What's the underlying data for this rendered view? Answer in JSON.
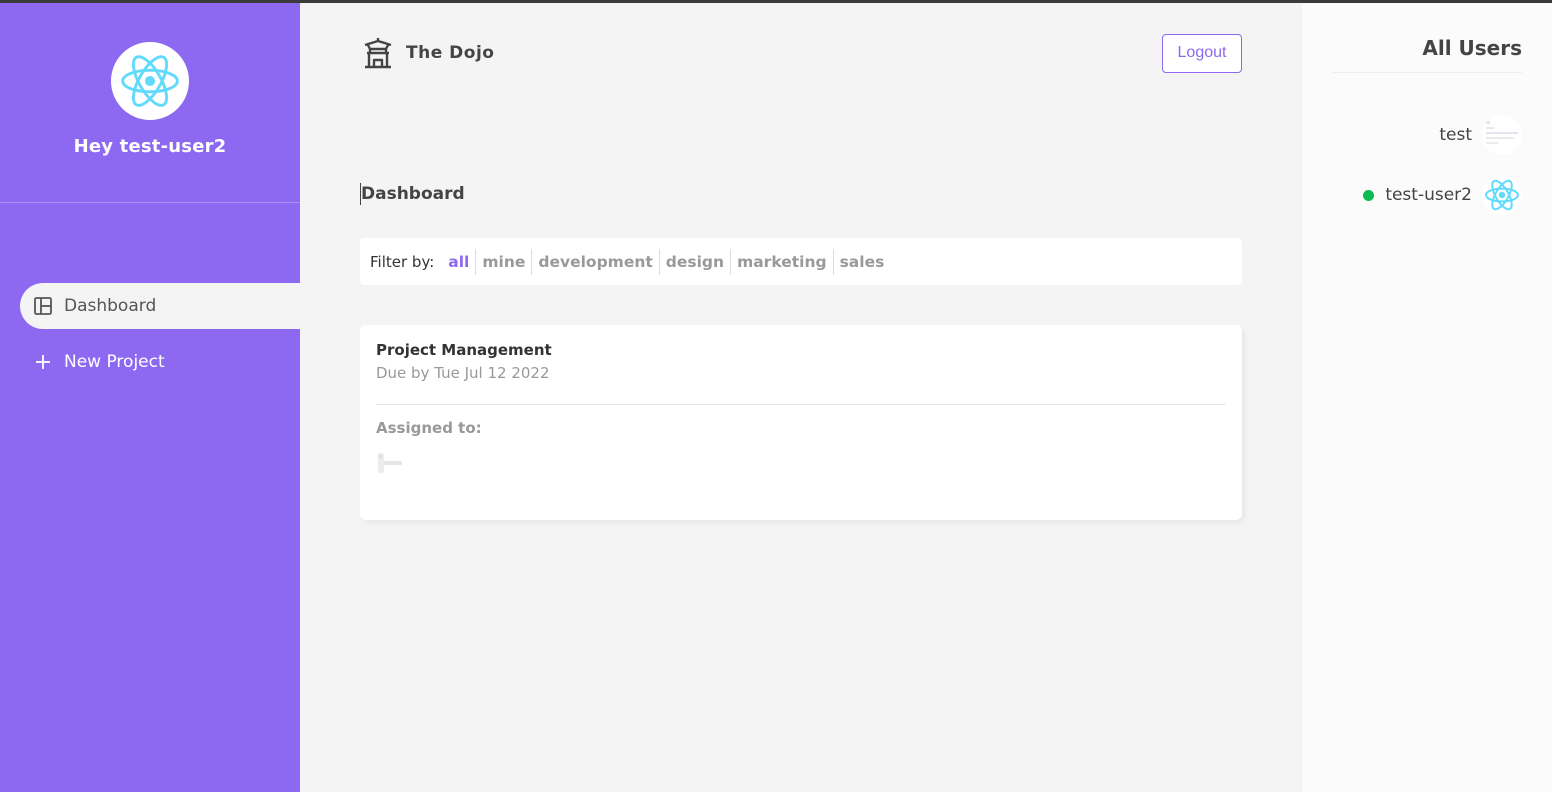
{
  "sidebar": {
    "greeting": "Hey test-user2",
    "avatar_icon": "react-logo-icon",
    "items": [
      {
        "label": "Dashboard",
        "icon": "dashboard-icon",
        "active": true
      },
      {
        "label": "New Project",
        "icon": "plus-icon",
        "active": false
      }
    ]
  },
  "navbar": {
    "logo_icon": "temple-icon",
    "brand": "The Dojo",
    "logout_label": "Logout"
  },
  "page": {
    "title": "Dashboard"
  },
  "filter": {
    "label": "Filter by:",
    "options": [
      "all",
      "mine",
      "development",
      "design",
      "marketing",
      "sales"
    ],
    "selected": "all"
  },
  "projects": [
    {
      "name": "Project Management",
      "due": "Due by Tue Jul 12 2022",
      "assigned_label": "Assigned to:"
    }
  ],
  "users_panel": {
    "title": "All Users",
    "users": [
      {
        "name": "test",
        "online": false
      },
      {
        "name": "test-user2",
        "online": true
      }
    ]
  },
  "colors": {
    "accent": "#8d69f1",
    "background": "#f4f4f4",
    "online": "#0ebb50",
    "react": "#61dafb"
  }
}
